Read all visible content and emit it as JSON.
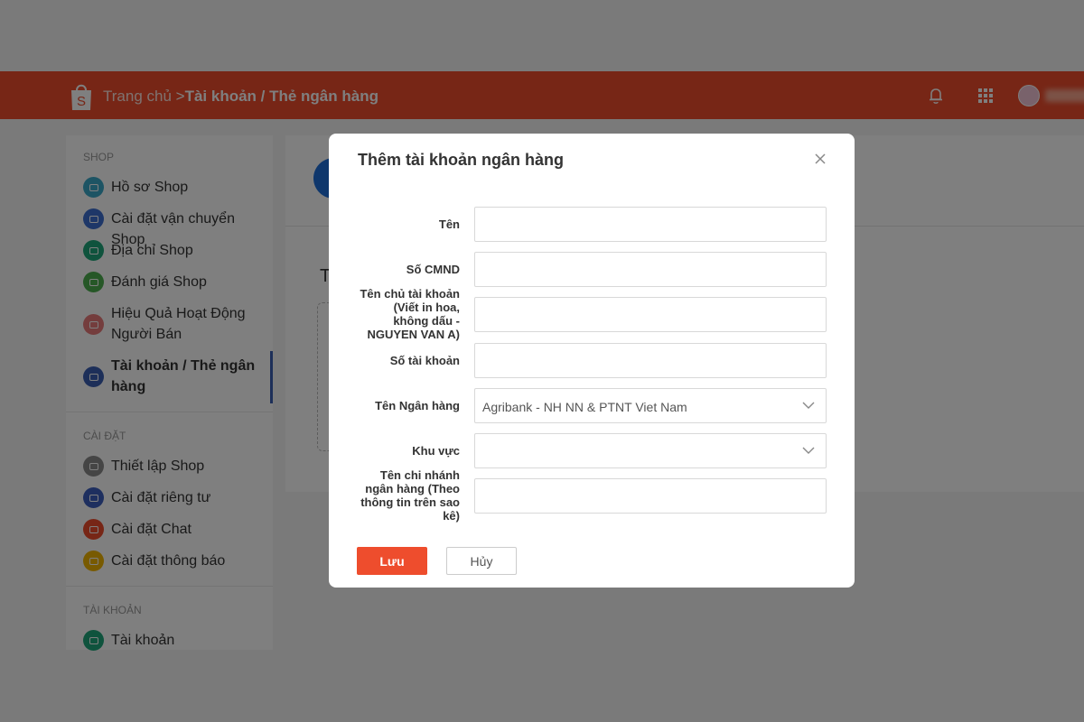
{
  "header": {
    "breadcrumb_home": "Trang chủ",
    "breadcrumb_separator": " >",
    "breadcrumb_current": "Tài khoản / Thẻ ngân hàng",
    "brand_color": "#ee4d2d",
    "icons": [
      "shop-bag-icon",
      "bell-icon",
      "apps-grid-icon",
      "user-avatar"
    ]
  },
  "sidebar": {
    "sections": [
      {
        "title": "SHOP"
      },
      {
        "title": "CÀI ĐẶT"
      },
      {
        "title": "TÀI KHOẢN"
      }
    ],
    "items": [
      {
        "label": "Hồ sơ Shop",
        "icon": "profile-icon",
        "color": "#3aa9c9"
      },
      {
        "label": "Cài đặt vận chuyển Shop",
        "icon": "truck-icon",
        "color": "#3d6fd1"
      },
      {
        "label": "Địa chỉ Shop",
        "icon": "location-pin-icon",
        "color": "#1fa67a"
      },
      {
        "label": "Đánh giá Shop",
        "icon": "star-icon",
        "color": "#4cae4f"
      },
      {
        "label": "Hiệu Quả Hoạt Động Người Bán",
        "icon": "chart-icon",
        "color": "#e87b7b"
      },
      {
        "label": "Tài khoản / Thẻ ngân hàng",
        "icon": "bank-card-icon",
        "color": "#3b5fb3",
        "active": true
      },
      {
        "label": "Thiết lập Shop",
        "icon": "gear-icon",
        "color": "#8a8a8a"
      },
      {
        "label": "Cài đặt riêng tư",
        "icon": "lock-icon",
        "color": "#3d5fbf"
      },
      {
        "label": "Cài đặt Chat",
        "icon": "chat-icon",
        "color": "#ee4d2d"
      },
      {
        "label": "Cài đặt thông báo",
        "icon": "notification-icon",
        "color": "#f0b400"
      },
      {
        "label": "Tài khoản",
        "icon": "account-icon",
        "color": "#1fa67a"
      }
    ]
  },
  "content": {
    "heading_initial": "T"
  },
  "modal": {
    "title": "Thêm tài khoản ngân hàng",
    "close_icon": "close-icon",
    "fields": [
      {
        "label": "Tên",
        "value": "",
        "type": "text"
      },
      {
        "label": "Số CMND",
        "value": "",
        "type": "text"
      },
      {
        "label": "Tên chủ tài khoản (Viết in hoa, không dấu - NGUYEN VAN A)",
        "value": "",
        "type": "text"
      },
      {
        "label": "Số tài khoản",
        "value": "",
        "type": "text"
      },
      {
        "label": "Tên Ngân hàng",
        "value": "Agribank - NH NN & PTNT Viet Nam",
        "type": "select"
      },
      {
        "label": "Khu vực",
        "value": "",
        "type": "select"
      },
      {
        "label": "Tên chi nhánh ngân hàng (Theo thông tin trên sao kê)",
        "value": "",
        "type": "text"
      }
    ],
    "save_label": "Lưu",
    "cancel_label": "Hủy"
  }
}
